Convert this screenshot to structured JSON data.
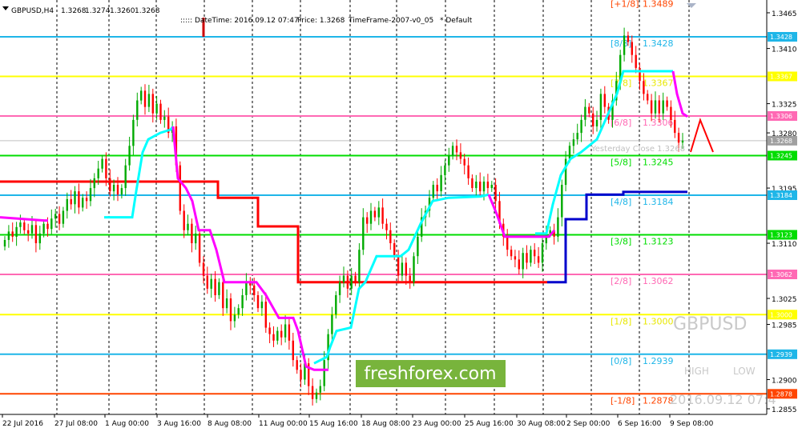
{
  "chart_data": {
    "type": "candlestick",
    "title": "GBPUSD,H4",
    "ohlc": {
      "open": "1.3268",
      "high": "1.3274",
      "low": "1.3260",
      "close": "1.3268"
    },
    "info": {
      "prefix": "::::: ",
      "datetime": "DateTime: 2016.09.12 07:47",
      "price": "Price: 1.3268",
      "timeframe": "TimeFrame-2007-v0_05",
      "default": "*  Default"
    },
    "ylim": [
      1.2845,
      1.3495
    ],
    "y_ticks": [
      "1.3465",
      "1.3410",
      "1.3325",
      "1.3280",
      "1.3195",
      "1.3110",
      "1.3025",
      "1.2985",
      "1.2900",
      "1.2855"
    ],
    "x_ticks": [
      "22 Jul 2016",
      "27 Jul 08:00",
      "1 Aug 00:00",
      "3 Aug 16:00",
      "8 Aug 08:00",
      "11 Aug 00:00",
      "15 Aug 16:00",
      "18 Aug 08:00",
      "23 Aug 00:00",
      "25 Aug 16:00",
      "30 Aug 08:00",
      "2 Sep 00:00",
      "6 Sep 16:00",
      "9 Sep 08:00"
    ],
    "murrey_levels": [
      {
        "label": "[+1/8]",
        "value": "1.3489",
        "price": 1.3489,
        "color": "#ff4500"
      },
      {
        "label": "[8/8]",
        "value": "1.3428",
        "price": 1.3428,
        "color": "#1fb6e8",
        "tag": "1.3428"
      },
      {
        "label": "[7/8]",
        "value": "1.3367",
        "price": 1.3367,
        "color": "#ffff00",
        "tag": "1.3367"
      },
      {
        "label": "[6/8]",
        "value": "1.3306",
        "price": 1.3306,
        "color": "#ff69b4",
        "tag": "1.3306"
      },
      {
        "label": "[5/8]",
        "value": "1.3245",
        "price": 1.3245,
        "color": "#00dd00",
        "tag": "1.3245"
      },
      {
        "label": "[4/8]",
        "value": "1.3184",
        "price": 1.3184,
        "color": "#1fb6e8",
        "tag": "1.3184"
      },
      {
        "label": "[3/8]",
        "value": "1.3123",
        "price": 1.3123,
        "color": "#00dd00",
        "tag": "1.3123"
      },
      {
        "label": "[2/8]",
        "value": "1.3062",
        "price": 1.3062,
        "color": "#ff69b4",
        "tag": "1.3062"
      },
      {
        "label": "[1/8]",
        "value": "1.3000",
        "price": 1.3,
        "color": "#ffff00",
        "tag": "1.3000"
      },
      {
        "label": "[0/8]",
        "value": "1.2939",
        "price": 1.2939,
        "color": "#1fb6e8",
        "tag": "1.2939"
      },
      {
        "label": "[-1/8]",
        "value": "1.2878",
        "price": 1.2878,
        "color": "#ff4500",
        "tag": "1.2878"
      }
    ],
    "current_price_tag": "1.3268",
    "yesterday_close_label": "Yesterday Close 1.3268",
    "symbol_watermark": "GBPUSD",
    "high_label": "HIGH",
    "low_label": "LOW",
    "time_watermark": "2016.09.12 07:4",
    "brand": "freshforex.com",
    "colors": {
      "bull": "#00aa00",
      "bear": "#ff0000",
      "cyan": "#00ffff",
      "magenta": "#ff00ff",
      "red_step": "#ff0000",
      "blue_step": "#0000cc"
    }
  }
}
